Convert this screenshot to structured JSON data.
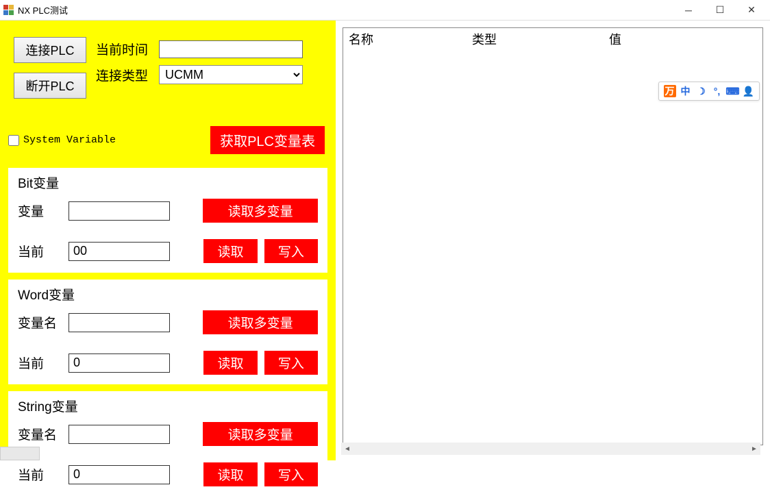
{
  "window": {
    "title": "NX PLC测试"
  },
  "left": {
    "connect_btn": "连接PLC",
    "disconnect_btn": "断开PLC",
    "time_label": "当前时间",
    "time_value": "",
    "conn_type_label": "连接类型",
    "conn_type_options": [
      "UCMM"
    ],
    "conn_type_selected": "UCMM",
    "sys_var_label": "System Variable",
    "sys_var_checked": false,
    "get_table_btn": "获取PLC变量表"
  },
  "groups": {
    "bit": {
      "title": "Bit变量",
      "var_label": "变量",
      "var_value": "",
      "read_multi": "读取多变量",
      "cur_label": "当前",
      "cur_value": "00",
      "read": "读取",
      "write": "写入"
    },
    "word": {
      "title": "Word变量",
      "var_label": "变量名",
      "var_value": "",
      "read_multi": "读取多变量",
      "cur_label": "当前",
      "cur_value": "0",
      "read": "读取",
      "write": "写入"
    },
    "string": {
      "title": "String变量",
      "var_label": "变量名",
      "var_value": "",
      "read_multi": "读取多变量",
      "cur_label": "当前",
      "cur_value": "0",
      "read": "读取",
      "write": "写入"
    }
  },
  "list": {
    "col_name": "名称",
    "col_type": "类型",
    "col_value": "值"
  },
  "ime": {
    "logo": "万",
    "cn": "中",
    "moon": "☽",
    "punct": "°,",
    "keyboard": "⌨",
    "user": "👤"
  }
}
